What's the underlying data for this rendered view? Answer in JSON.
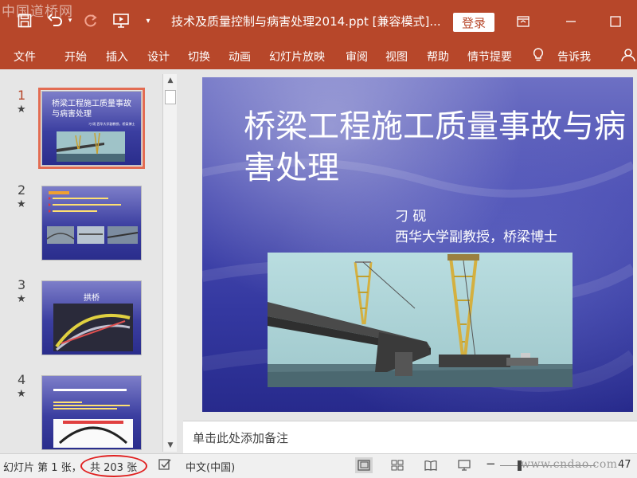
{
  "watermark": "中国道桥网",
  "titlebar": {
    "doc_title": "技术及质量控制与病害处理2014.ppt [兼容模式]...",
    "login_label": "登录"
  },
  "ribbon": {
    "tabs": [
      "文件",
      "开始",
      "插入",
      "设计",
      "切换",
      "动画",
      "幻灯片放映",
      "审阅",
      "视图",
      "帮助",
      "情节提要",
      "告诉我"
    ]
  },
  "thumbnails": [
    {
      "num": "1",
      "star": "★",
      "title": "桥梁工程施工质量事故与病害处理",
      "sub": "刁 砚  西华大学副教授，桥梁博士"
    },
    {
      "num": "2",
      "star": "★",
      "title": "",
      "sub": ""
    },
    {
      "num": "3",
      "star": "★",
      "title": "拱桥",
      "sub": ""
    },
    {
      "num": "4",
      "star": "★",
      "title": "",
      "sub": ""
    }
  ],
  "slide": {
    "title": "桥梁工程施工质量事故与病害处理",
    "author": "刁  砚",
    "affiliation": "西华大学副教授，桥梁博士"
  },
  "notes_placeholder": "单击此处添加备注",
  "statusbar": {
    "slide_info": "幻灯片 第 1 张，",
    "total": "共 203 张",
    "language": "中文(中国)",
    "site_watermark": "www.cndao.com",
    "zoom": "47"
  },
  "colors": {
    "accent": "#b7472a",
    "highlight_circle": "#e02020"
  }
}
